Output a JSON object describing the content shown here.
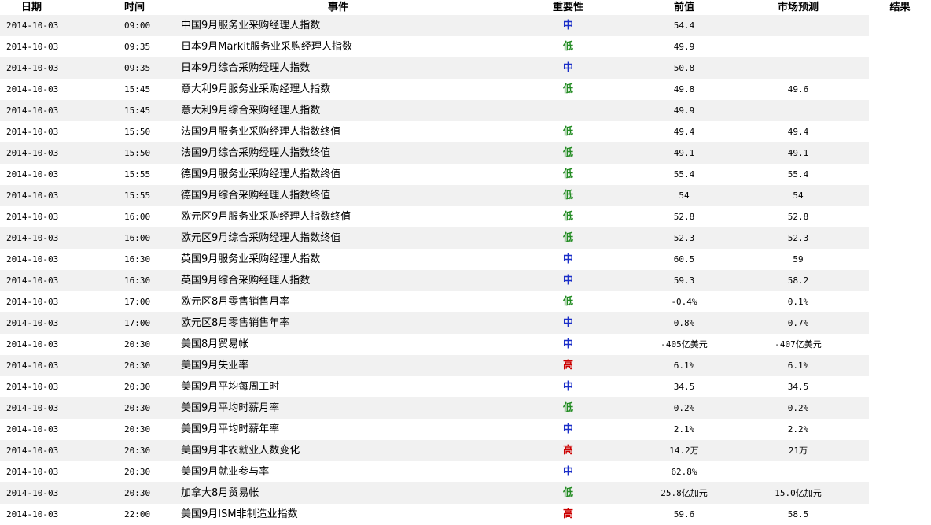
{
  "headers": {
    "date": "日期",
    "time": "时间",
    "event": "事件",
    "importance": "重要性",
    "previous": "前值",
    "forecast": "市场预测",
    "result": "结果"
  },
  "rows": [
    {
      "date": "2014-10-03",
      "time": "09:00",
      "event": "中国9月服务业采购经理人指数",
      "importance": "中",
      "previous": "54.4",
      "forecast": "",
      "result": ""
    },
    {
      "date": "2014-10-03",
      "time": "09:35",
      "event": "日本9月Markit服务业采购经理人指数",
      "importance": "低",
      "previous": "49.9",
      "forecast": "",
      "result": ""
    },
    {
      "date": "2014-10-03",
      "time": "09:35",
      "event": "日本9月综合采购经理人指数",
      "importance": "中",
      "previous": "50.8",
      "forecast": "",
      "result": ""
    },
    {
      "date": "2014-10-03",
      "time": "15:45",
      "event": "意大利9月服务业采购经理人指数",
      "importance": "低",
      "previous": "49.8",
      "forecast": "49.6",
      "result": ""
    },
    {
      "date": "2014-10-03",
      "time": "15:45",
      "event": "意大利9月综合采购经理人指数",
      "importance": "",
      "previous": "49.9",
      "forecast": "",
      "result": ""
    },
    {
      "date": "2014-10-03",
      "time": "15:50",
      "event": "法国9月服务业采购经理人指数终值",
      "importance": "低",
      "previous": "49.4",
      "forecast": "49.4",
      "result": ""
    },
    {
      "date": "2014-10-03",
      "time": "15:50",
      "event": "法国9月综合采购经理人指数终值",
      "importance": "低",
      "previous": "49.1",
      "forecast": "49.1",
      "result": ""
    },
    {
      "date": "2014-10-03",
      "time": "15:55",
      "event": "德国9月服务业采购经理人指数终值",
      "importance": "低",
      "previous": "55.4",
      "forecast": "55.4",
      "result": ""
    },
    {
      "date": "2014-10-03",
      "time": "15:55",
      "event": "德国9月综合采购经理人指数终值",
      "importance": "低",
      "previous": "54",
      "forecast": "54",
      "result": ""
    },
    {
      "date": "2014-10-03",
      "time": "16:00",
      "event": "欧元区9月服务业采购经理人指数终值",
      "importance": "低",
      "previous": "52.8",
      "forecast": "52.8",
      "result": ""
    },
    {
      "date": "2014-10-03",
      "time": "16:00",
      "event": "欧元区9月综合采购经理人指数终值",
      "importance": "低",
      "previous": "52.3",
      "forecast": "52.3",
      "result": ""
    },
    {
      "date": "2014-10-03",
      "time": "16:30",
      "event": "英国9月服务业采购经理人指数",
      "importance": "中",
      "previous": "60.5",
      "forecast": "59",
      "result": ""
    },
    {
      "date": "2014-10-03",
      "time": "16:30",
      "event": "英国9月综合采购经理人指数",
      "importance": "中",
      "previous": "59.3",
      "forecast": "58.2",
      "result": ""
    },
    {
      "date": "2014-10-03",
      "time": "17:00",
      "event": "欧元区8月零售销售月率",
      "importance": "低",
      "previous": "-0.4%",
      "forecast": "0.1%",
      "result": ""
    },
    {
      "date": "2014-10-03",
      "time": "17:00",
      "event": "欧元区8月零售销售年率",
      "importance": "中",
      "previous": "0.8%",
      "forecast": "0.7%",
      "result": ""
    },
    {
      "date": "2014-10-03",
      "time": "20:30",
      "event": "美国8月贸易帐",
      "importance": "中",
      "previous": "-405亿美元",
      "forecast": "-407亿美元",
      "result": ""
    },
    {
      "date": "2014-10-03",
      "time": "20:30",
      "event": "美国9月失业率",
      "importance": "高",
      "previous": "6.1%",
      "forecast": "6.1%",
      "result": ""
    },
    {
      "date": "2014-10-03",
      "time": "20:30",
      "event": "美国9月平均每周工时",
      "importance": "中",
      "previous": "34.5",
      "forecast": "34.5",
      "result": ""
    },
    {
      "date": "2014-10-03",
      "time": "20:30",
      "event": "美国9月平均时薪月率",
      "importance": "低",
      "previous": "0.2%",
      "forecast": "0.2%",
      "result": ""
    },
    {
      "date": "2014-10-03",
      "time": "20:30",
      "event": "美国9月平均时薪年率",
      "importance": "中",
      "previous": "2.1%",
      "forecast": "2.2%",
      "result": ""
    },
    {
      "date": "2014-10-03",
      "time": "20:30",
      "event": "美国9月非农就业人数变化",
      "importance": "高",
      "previous": "14.2万",
      "forecast": "21万",
      "result": ""
    },
    {
      "date": "2014-10-03",
      "time": "20:30",
      "event": "美国9月就业参与率",
      "importance": "中",
      "previous": "62.8%",
      "forecast": "",
      "result": ""
    },
    {
      "date": "2014-10-03",
      "time": "20:30",
      "event": "加拿大8月贸易帐",
      "importance": "低",
      "previous": "25.8亿加元",
      "forecast": "15.0亿加元",
      "result": ""
    },
    {
      "date": "2014-10-03",
      "time": "22:00",
      "event": "美国9月ISM非制造业指数",
      "importance": "高",
      "previous": "59.6",
      "forecast": "58.5",
      "result": ""
    }
  ],
  "colors": {
    "high": "#cc0000",
    "medium": "#1a2ec8",
    "low": "#228b22",
    "row_alt": "#f1f1f1"
  }
}
